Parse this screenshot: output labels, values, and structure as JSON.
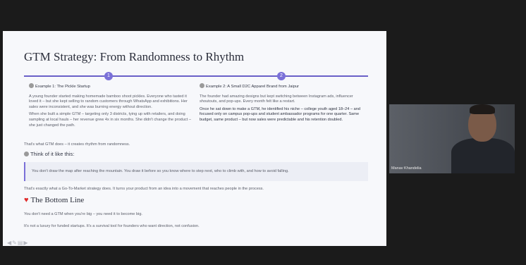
{
  "slide": {
    "title": "GTM Strategy: From Randomness to Rhythm",
    "timeline": [
      "1",
      "2"
    ],
    "example1": {
      "heading": "Example 1: The Pickle Startup",
      "para1": "A young founder started making homemade bamboo shoot pickles. Everyone who tasted it loved it – but she kept selling to random customers through WhatsApp and exhibitions. Her sales were inconsistent, and she was burning energy without direction.",
      "para2": "When she built a simple GTM – targeting only 3 districts, tying up with retailers, and doing sampling at local hauls – her revenue grew 4x in six months. She didn't change the product – she just changed the path."
    },
    "example2": {
      "heading": "Example 2: A Small D2C Apparel Brand from Jaipur",
      "para1": "The founder had amazing designs but kept switching between Instagram ads, influencer shoutouts, and pop-ups. Every month felt like a restart.",
      "para2": "Once he sat down to make a GTM, he identified his niche – college youth aged 18–24 – and focused only on campus pop-ups and student ambassador programs for one quarter. Same budget, same product – but now sales were predictable and his retention doubled."
    },
    "summary": "That's what GTM does – it creates rhythm from randomness.",
    "think_heading": "Think of it like this:",
    "quote": "You don't draw the map after reaching the mountain. You draw it before so you know where to step next, who to climb with, and how to avoid falling.",
    "explain": "That's exactly what a Go-To-Market strategy does. It turns your product from an idea into a movement that reaches people in the process.",
    "bottom_title": "The Bottom Line",
    "bottom_line1": "You don't need a GTM when you're big – you need it to become big.",
    "bottom_line2": "It's not a luxury for funded startups. It's a survival tool for founders who want direction, not confusion."
  },
  "video": {
    "participant_name": "Manav Khandelia"
  },
  "colors": {
    "accent": "#7a70d8",
    "heart": "#e02b2b"
  }
}
